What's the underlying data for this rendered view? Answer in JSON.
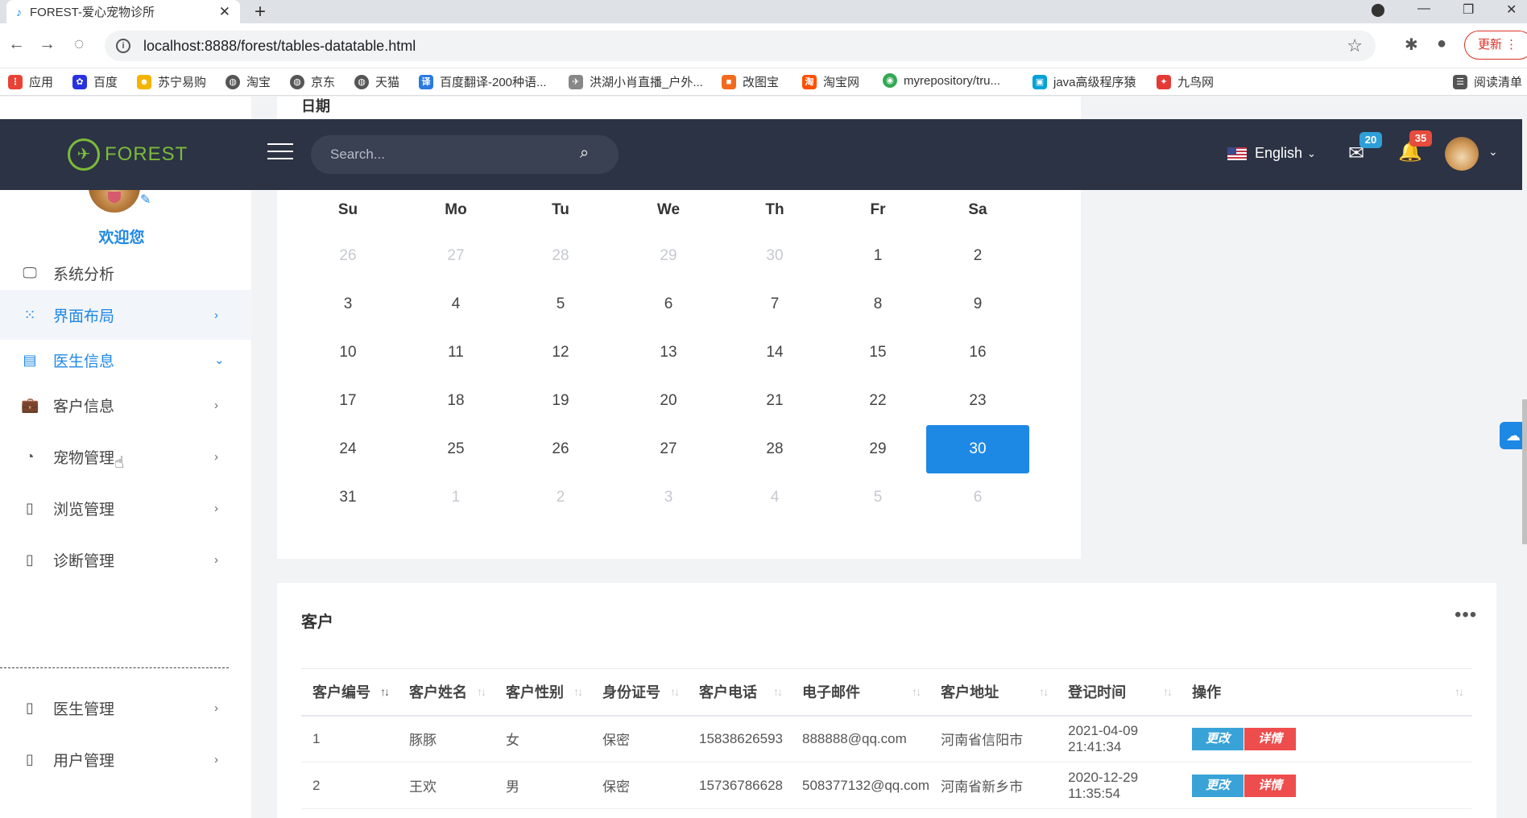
{
  "browser": {
    "tab_title": "FOREST-爱心宠物诊所",
    "url": "localhost:8888/forest/tables-datatable.html",
    "update_label": "更新",
    "bookmarks": [
      {
        "label": "应用",
        "color": "#e94235"
      },
      {
        "label": "百度",
        "color": "#2932e1"
      },
      {
        "label": "苏宁易购",
        "color": "#f5b400"
      },
      {
        "label": "淘宝",
        "color": "#555555"
      },
      {
        "label": "京东",
        "color": "#555555"
      },
      {
        "label": "天猫",
        "color": "#555555"
      },
      {
        "label": "百度翻译-200种语...",
        "color": "#2a7ae2"
      },
      {
        "label": "洪湖小肖直播_户外...",
        "color": "#888888"
      },
      {
        "label": "改图宝",
        "color": "#f26b1d"
      },
      {
        "label": "淘宝网",
        "color": "#ff5000"
      },
      {
        "label": "myrepository/tru...",
        "color": "#34a853"
      },
      {
        "label": "java高级程序猿",
        "color": "#00a1d6"
      },
      {
        "label": "九鸟网",
        "color": "#e53935"
      },
      {
        "label": "阅读清单",
        "color": "#555555"
      }
    ]
  },
  "header": {
    "logo_text": "FOREST",
    "search_placeholder": "Search...",
    "language": "English",
    "mail_count": "20",
    "notification_count": "35",
    "mail_badge_color": "#2e9fd9",
    "notification_badge_color": "#e74c3c"
  },
  "sidebar": {
    "welcome": "欢迎您",
    "items": [
      {
        "label": "系统分析",
        "icon": "monitor-icon"
      },
      {
        "label": "界面布局",
        "icon": "grid-icon"
      },
      {
        "label": "医生信息",
        "icon": "calendar-icon"
      },
      {
        "label": "客户信息",
        "icon": "briefcase-icon"
      },
      {
        "label": "宠物管理",
        "icon": "pie-icon"
      },
      {
        "label": "浏览管理",
        "icon": "document-icon"
      },
      {
        "label": "诊断管理",
        "icon": "document-icon"
      },
      {
        "label": "医生管理",
        "icon": "document-icon"
      },
      {
        "label": "用户管理",
        "icon": "document-icon"
      }
    ]
  },
  "calendar": {
    "title": "日期",
    "weekdays": [
      "Su",
      "Mo",
      "Tu",
      "We",
      "Th",
      "Fr",
      "Sa"
    ],
    "weeks": [
      [
        "26",
        "27",
        "28",
        "29",
        "30",
        "1",
        "2"
      ],
      [
        "3",
        "4",
        "5",
        "6",
        "7",
        "8",
        "9"
      ],
      [
        "10",
        "11",
        "12",
        "13",
        "14",
        "15",
        "16"
      ],
      [
        "17",
        "18",
        "19",
        "20",
        "21",
        "22",
        "23"
      ],
      [
        "24",
        "25",
        "26",
        "27",
        "28",
        "29",
        "30"
      ],
      [
        "31",
        "1",
        "2",
        "3",
        "4",
        "5",
        "6"
      ]
    ],
    "selected_day": "30",
    "accent": "#1e88e5"
  },
  "customers": {
    "title": "客户",
    "columns": [
      "客户编号",
      "客户姓名",
      "客户性别",
      "身份证号",
      "客户电话",
      "电子邮件",
      "客户地址",
      "登记时间",
      "操作"
    ],
    "rows": [
      {
        "id": "1",
        "name": "豚豚",
        "gender": "女",
        "id_card": "保密",
        "phone": "15838626593",
        "email": "888888@qq.com",
        "address": "河南省信阳市",
        "registered": "2021-04-09 21:41:34"
      },
      {
        "id": "2",
        "name": "王欢",
        "gender": "男",
        "id_card": "保密",
        "phone": "15736786628",
        "email": "508377132@qq.com",
        "address": "河南省新乡市",
        "registered": "2020-12-29 11:35:54"
      }
    ],
    "edit_label": "更改",
    "detail_label": "详情"
  }
}
